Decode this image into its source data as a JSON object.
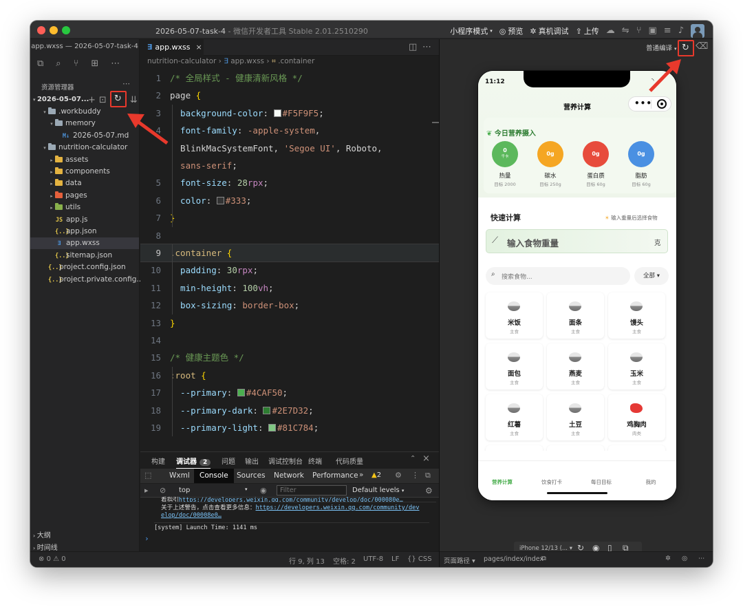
{
  "window": {
    "title": "2026-05-07-task-4",
    "app_name": "微信开发者工具 Stable 2.01.2510290",
    "file_title": "app.wxss — 2026-05-07-task-4"
  },
  "toolbar": {
    "mode": "小程序模式",
    "preview": "预览",
    "real_debug": "真机调试",
    "upload": "上传"
  },
  "explorer": {
    "header": "资源管理器",
    "project": "2026-05-07...",
    "tree": [
      {
        "label": ".workbuddy",
        "indent": 1,
        "kind": "folder",
        "open": true,
        "color": "#9ba9b5"
      },
      {
        "label": "memory",
        "indent": 2,
        "kind": "folder",
        "open": true,
        "color": "#9ba9b5"
      },
      {
        "label": "2026-05-07.md",
        "indent": 3,
        "kind": "md",
        "icon": "M↓",
        "color": "#4b8fd4"
      },
      {
        "label": "nutrition-calculator",
        "indent": 1,
        "kind": "folder",
        "open": true,
        "color": "#9ba9b5"
      },
      {
        "label": "assets",
        "indent": 2,
        "kind": "folder",
        "open": false,
        "color": "#e4b341"
      },
      {
        "label": "components",
        "indent": 2,
        "kind": "folder",
        "open": false,
        "color": "#e4b341"
      },
      {
        "label": "data",
        "indent": 2,
        "kind": "folder",
        "open": false,
        "color": "#e4b341"
      },
      {
        "label": "pages",
        "indent": 2,
        "kind": "folder",
        "open": false,
        "color": "#e5603c"
      },
      {
        "label": "utils",
        "indent": 2,
        "kind": "folder",
        "open": false,
        "color": "#88b04b"
      },
      {
        "label": "app.js",
        "indent": 2,
        "kind": "file",
        "icon": "JS",
        "color": "#e6c84a"
      },
      {
        "label": "app.json",
        "indent": 2,
        "kind": "file",
        "icon": "{..}",
        "color": "#e6c84a"
      },
      {
        "label": "app.wxss",
        "indent": 2,
        "kind": "file",
        "icon": "∃",
        "color": "#4b8fd4",
        "selected": true
      },
      {
        "label": "sitemap.json",
        "indent": 2,
        "kind": "file",
        "icon": "{..}",
        "color": "#e6c84a"
      },
      {
        "label": "project.config.json",
        "indent": 1,
        "kind": "file",
        "icon": "{..}",
        "color": "#e6c84a"
      },
      {
        "label": "project.private.config...",
        "indent": 1,
        "kind": "file",
        "icon": "{..}",
        "color": "#e6c84a"
      }
    ],
    "outline": "大纲",
    "timeline": "时间线",
    "problems": "0",
    "warnings": "0"
  },
  "editor": {
    "tab": "app.wxss",
    "breadcrumb": [
      "nutrition-calculator",
      "app.wxss",
      ".container"
    ],
    "lines": [
      {
        "n": "1",
        "t": [
          [
            "c-cm",
            "/* 全局样式 - 健康清新风格 */"
          ]
        ]
      },
      {
        "n": "2",
        "t": [
          [
            "c-tx",
            "page "
          ],
          [
            "c-br",
            "{"
          ]
        ]
      },
      {
        "n": "3",
        "t": [
          [
            "c-pr",
            "  background-color"
          ],
          [
            "c-tx",
            ": "
          ],
          [
            "sw",
            "#F5F9F5"
          ],
          [
            "c-vl",
            "#F5F9F5"
          ],
          [
            "c-tx",
            ";"
          ]
        ]
      },
      {
        "n": "4",
        "t": [
          [
            "c-pr",
            "  font-family"
          ],
          [
            "c-tx",
            ": "
          ],
          [
            "c-vl",
            "-apple-system"
          ],
          [
            "c-tx",
            ","
          ]
        ]
      },
      {
        "n": "",
        "t": [
          [
            "c-tx",
            "  BlinkMacSystemFont, "
          ],
          [
            "c-vl",
            "'Segoe UI'"
          ],
          [
            "c-tx",
            ", Roboto,"
          ]
        ]
      },
      {
        "n": "",
        "t": [
          [
            "c-vl",
            "  sans-serif"
          ],
          [
            "c-tx",
            ";"
          ]
        ]
      },
      {
        "n": "5",
        "t": [
          [
            "c-pr",
            "  font-size"
          ],
          [
            "c-tx",
            ": "
          ],
          [
            "c-nm",
            "28"
          ],
          [
            "c-un",
            "rpx"
          ],
          [
            "c-tx",
            ";"
          ]
        ]
      },
      {
        "n": "6",
        "t": [
          [
            "c-pr",
            "  color"
          ],
          [
            "c-tx",
            ": "
          ],
          [
            "sw",
            "#333"
          ],
          [
            "c-vl",
            "#333"
          ],
          [
            "c-tx",
            ";"
          ]
        ]
      },
      {
        "n": "7",
        "t": [
          [
            "c-br",
            "}"
          ]
        ]
      },
      {
        "n": "8",
        "t": []
      },
      {
        "n": "9",
        "t": [
          [
            "c-sel",
            ".container "
          ],
          [
            "c-br",
            "{"
          ]
        ],
        "cur": true
      },
      {
        "n": "10",
        "t": [
          [
            "c-pr",
            "  padding"
          ],
          [
            "c-tx",
            ": "
          ],
          [
            "c-nm",
            "30"
          ],
          [
            "c-un",
            "rpx"
          ],
          [
            "c-tx",
            ";"
          ]
        ]
      },
      {
        "n": "11",
        "t": [
          [
            "c-pr",
            "  min-height"
          ],
          [
            "c-tx",
            ": "
          ],
          [
            "c-nm",
            "100"
          ],
          [
            "c-un",
            "vh"
          ],
          [
            "c-tx",
            ";"
          ]
        ]
      },
      {
        "n": "12",
        "t": [
          [
            "c-pr",
            "  box-sizing"
          ],
          [
            "c-tx",
            ": "
          ],
          [
            "c-vl",
            "border-box"
          ],
          [
            "c-tx",
            ";"
          ]
        ]
      },
      {
        "n": "13",
        "t": [
          [
            "c-br",
            "}"
          ]
        ]
      },
      {
        "n": "14",
        "t": []
      },
      {
        "n": "15",
        "t": [
          [
            "c-cm",
            "/* 健康主题色 */"
          ]
        ]
      },
      {
        "n": "16",
        "t": [
          [
            "c-sel",
            ":root "
          ],
          [
            "c-br",
            "{"
          ]
        ]
      },
      {
        "n": "17",
        "t": [
          [
            "c-pr",
            "  --primary"
          ],
          [
            "c-tx",
            ": "
          ],
          [
            "sw",
            "#4CAF50"
          ],
          [
            "c-vl",
            "#4CAF50"
          ],
          [
            "c-tx",
            ";"
          ]
        ]
      },
      {
        "n": "18",
        "t": [
          [
            "c-pr",
            "  --primary-dark"
          ],
          [
            "c-tx",
            ": "
          ],
          [
            "sw",
            "#2E7D32"
          ],
          [
            "c-vl",
            "#2E7D32"
          ],
          [
            "c-tx",
            ";"
          ]
        ]
      },
      {
        "n": "19",
        "t": [
          [
            "c-pr",
            "  --primary-light"
          ],
          [
            "c-tx",
            ": "
          ],
          [
            "sw",
            "#81C784"
          ],
          [
            "c-vl",
            "#81C784"
          ],
          [
            "c-tx",
            ";"
          ]
        ]
      }
    ]
  },
  "panel": {
    "tabs": [
      "构建",
      "调试器",
      "问题",
      "输出",
      "调试控制台",
      "终端",
      "代码质量"
    ],
    "debugger_badge": "2",
    "devtools_tabs": [
      "Wxml",
      "Console",
      "Sources",
      "Network",
      "Performance"
    ],
    "warn_count": "2",
    "context": "top",
    "filter_placeholder": "Filter",
    "levels": "Default levels",
    "console": {
      "line1_prefix": "看指引",
      "line1_link": "https://developers.weixin.qq.com/community/develop/doc/000080e…",
      "line2_prefix": "关于上述警告，点击查看更多信息：",
      "line2_link": "https://developers.weixin.qq.com/community/develop/doc/00008e0…",
      "line3": "[system] Launch Time: 1141 ms"
    }
  },
  "status": {
    "position": "行 9, 列 13",
    "spaces": "空格: 2",
    "encoding": "UTF-8",
    "eol": "LF",
    "lang": "CSS"
  },
  "sim": {
    "compile_mode": "普通编译",
    "device": "iPhone 12/13 (...",
    "page_path_label": "页面路径",
    "page_path": "pages/index/index"
  },
  "phone": {
    "time": "11:12",
    "nav_title": "营养计算",
    "today_title": "今日营养摄入",
    "nutrients": [
      {
        "value": "0",
        "unit": "千卡",
        "name": "热量",
        "target": "目标 2000",
        "color": "#5cb85c"
      },
      {
        "value": "0g",
        "unit": "",
        "name": "碳水",
        "target": "目标 250g",
        "color": "#f5a623"
      },
      {
        "value": "0g",
        "unit": "",
        "name": "蛋白质",
        "target": "目标 60g",
        "color": "#e74c3c"
      },
      {
        "value": "0g",
        "unit": "",
        "name": "脂肪",
        "target": "目标 60g",
        "color": "#4a90e2"
      }
    ],
    "quick_title": "快速计算",
    "quick_hint": "输入重量后选择食物",
    "weight_placeholder": "输入食物重量",
    "weight_unit": "克",
    "search_placeholder": "搜索食物...",
    "filter_all": "全部 ▾",
    "foods": [
      {
        "name": "米饭",
        "cat": "主食",
        "kind": "bowl"
      },
      {
        "name": "面条",
        "cat": "主食",
        "kind": "bowl"
      },
      {
        "name": "馒头",
        "cat": "主食",
        "kind": "bowl"
      },
      {
        "name": "面包",
        "cat": "主食",
        "kind": "bowl"
      },
      {
        "name": "燕麦",
        "cat": "主食",
        "kind": "bowl"
      },
      {
        "name": "玉米",
        "cat": "主食",
        "kind": "bowl"
      },
      {
        "name": "红薯",
        "cat": "主食",
        "kind": "bowl"
      },
      {
        "name": "土豆",
        "cat": "主食",
        "kind": "bowl"
      },
      {
        "name": "鸡胸肉",
        "cat": "肉类",
        "kind": "meat"
      }
    ],
    "tabs": [
      "营养计算",
      "饮食打卡",
      "每日目标",
      "我的"
    ]
  }
}
